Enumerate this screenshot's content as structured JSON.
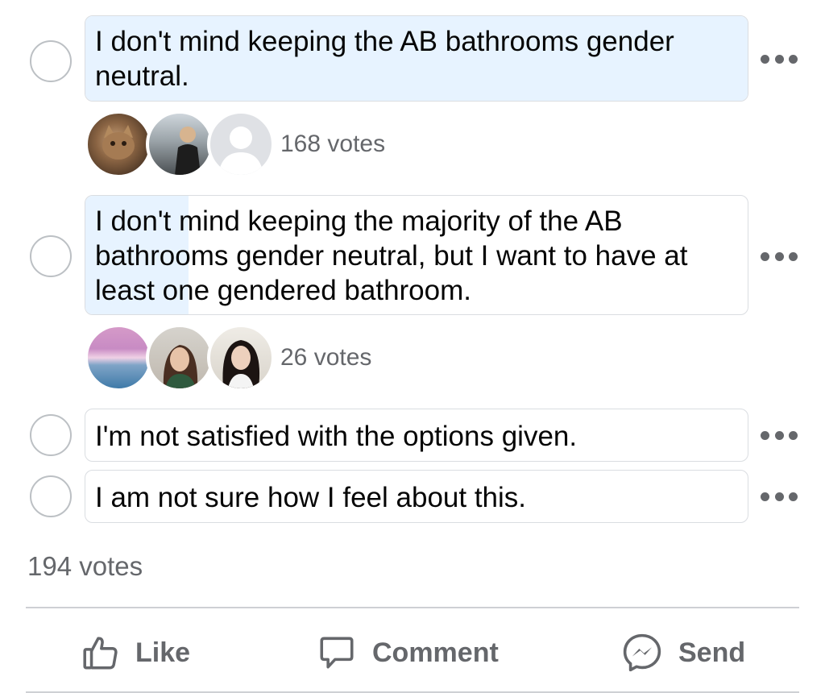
{
  "poll": {
    "options": [
      {
        "text": "I don't mind keeping the AB bathrooms gender neutral.",
        "votes_label": "168 votes",
        "share": 0.87
      },
      {
        "text": "I don't mind keeping the majority of the AB bathrooms gender neutral, but I want to have at least one gendered bathroom.",
        "votes_label": "26 votes",
        "share": 0.13
      },
      {
        "text": "I'm not satisfied with the options given.",
        "share": 0
      },
      {
        "text": "I am not sure how I feel about this.",
        "share": 0
      }
    ],
    "total_votes": "194 votes"
  },
  "actions": {
    "like": "Like",
    "comment": "Comment",
    "send": "Send"
  },
  "colors": {
    "selected_fill": "#e7f3ff",
    "border": "#dadde1",
    "muted_text": "#65676b"
  }
}
